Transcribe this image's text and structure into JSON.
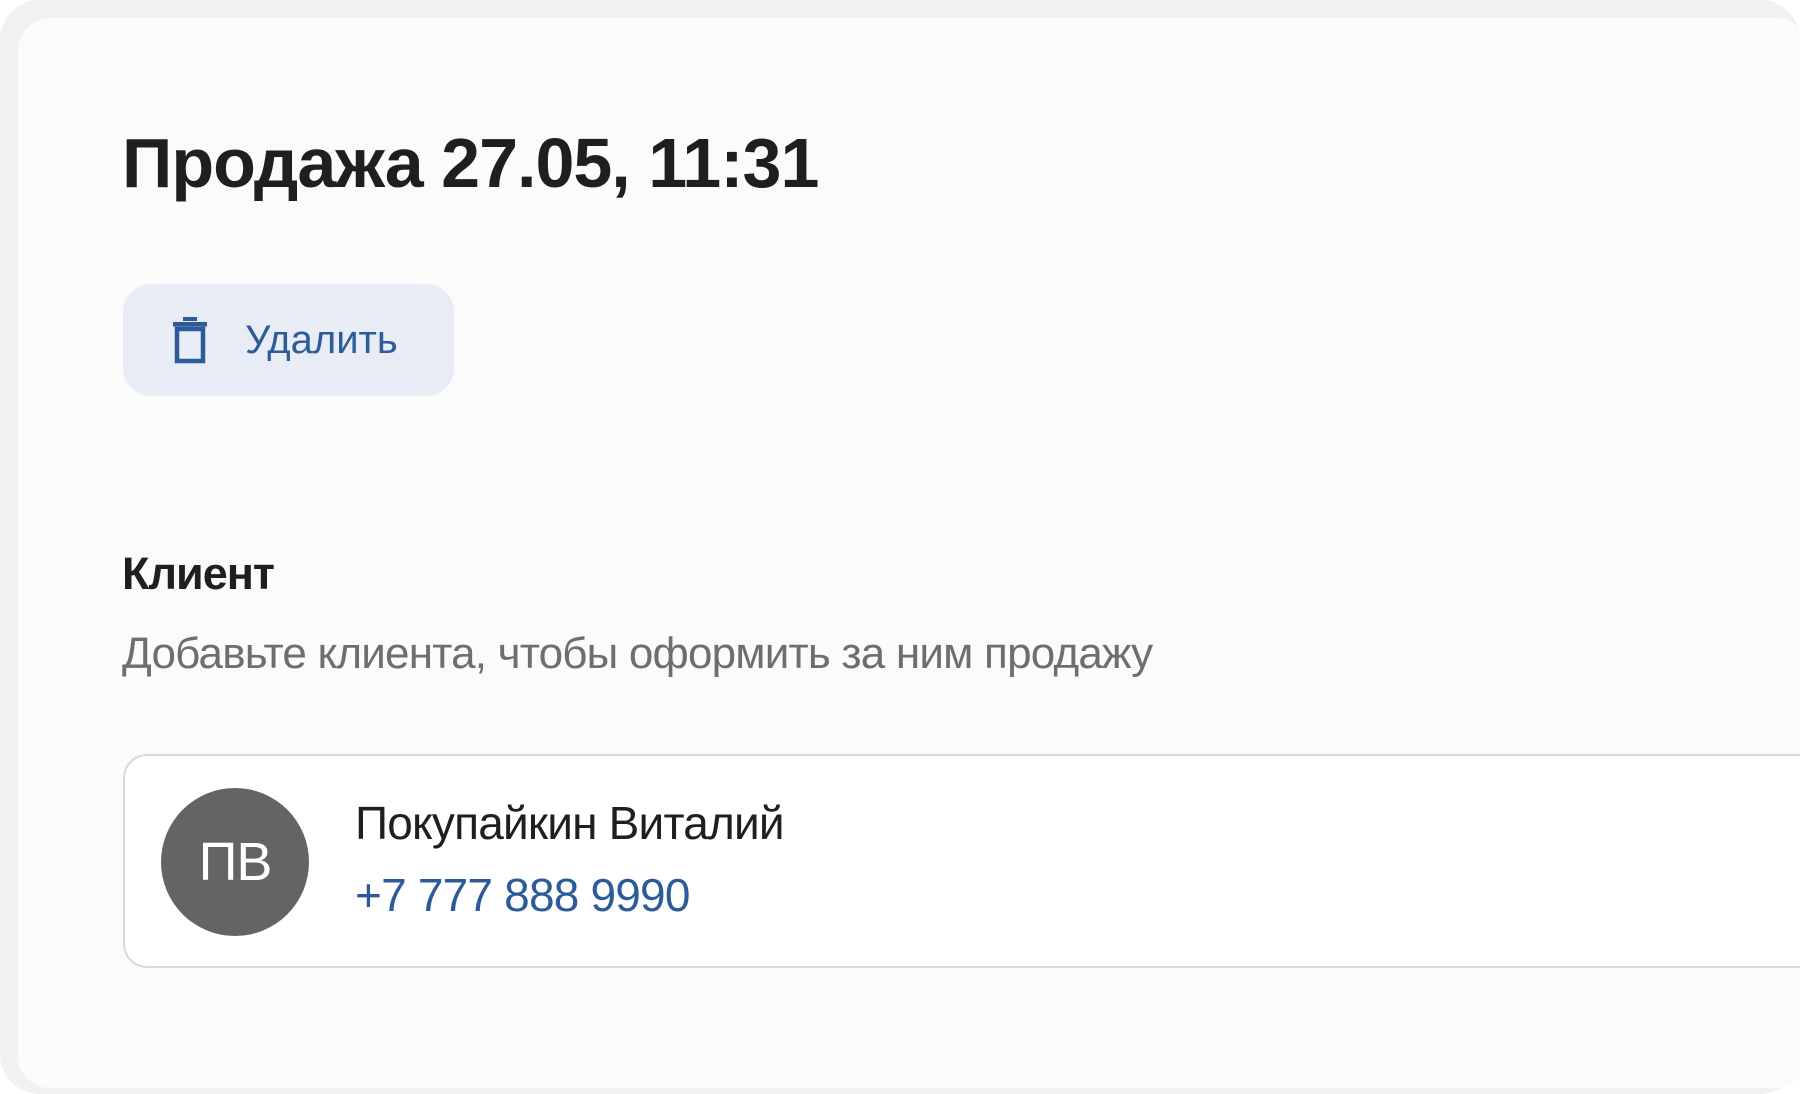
{
  "sale": {
    "title": "Продажа 27.05, 11:31"
  },
  "actions": {
    "delete_label": "Удалить",
    "delete_icon": "trash-icon"
  },
  "client_section": {
    "title": "Клиент",
    "hint": "Добавьте клиента, чтобы оформить за ним продажу",
    "client": {
      "initials": "ПВ",
      "name": "Покупайкин Виталий",
      "phone": "+7 777 888 9990"
    }
  },
  "colors": {
    "accent": "#2d5b9a",
    "button_bg": "#e8edf5",
    "avatar_bg": "#646464",
    "text_primary": "#1f1f1f",
    "text_secondary": "#6e6e6e"
  }
}
